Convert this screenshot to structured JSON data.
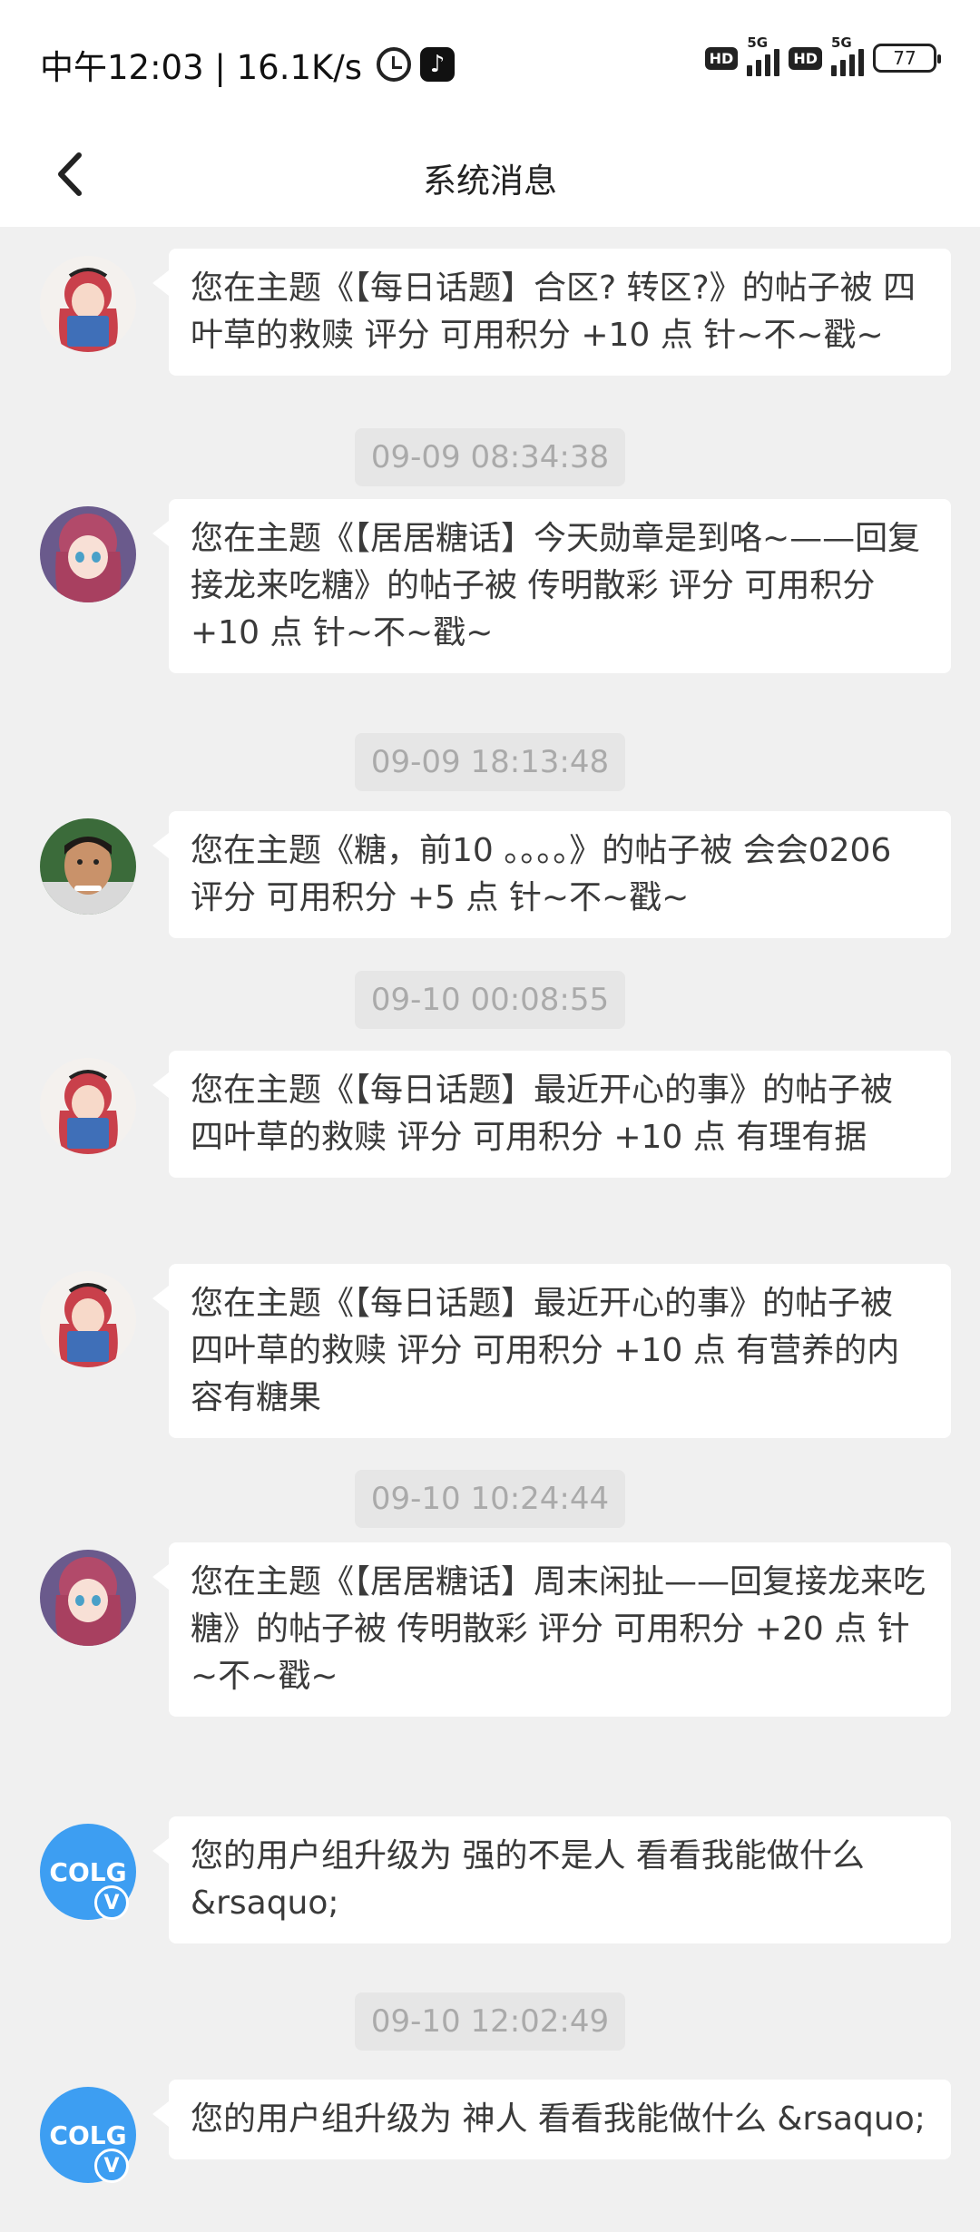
{
  "status_bar": {
    "time_speed": "中午12:03 | 16.1K/s",
    "network_1": "5G",
    "network_2": "5G",
    "hd_label": "HD",
    "battery": "77"
  },
  "nav": {
    "title": "系统消息"
  },
  "messages": [
    {
      "type": "message",
      "avatar": "anime-girl-book",
      "text": "您在主题《【每日话题】合区? 转区?》的帖子被 四叶草的救赎 评分 可用积分 +10 点 针~不~戳~"
    },
    {
      "type": "timestamp",
      "text": "09-09 08:34:38"
    },
    {
      "type": "message",
      "avatar": "anime-girl-purple",
      "text": "您在主题《【居居糖话】今天勋章是到咯~——回复接龙来吃糖》的帖子被 传明散彩 评分 可用积分 +10 点 针~不~戳~"
    },
    {
      "type": "timestamp",
      "text": "09-09 18:13:48"
    },
    {
      "type": "message",
      "avatar": "man-photo",
      "text": "您在主题《糖，前10 。。。。》的帖子被 会会0206 评分 可用积分 +5 点 针~不~戳~"
    },
    {
      "type": "timestamp",
      "text": "09-10 00:08:55"
    },
    {
      "type": "message",
      "avatar": "anime-girl-book",
      "text": "您在主题《【每日话题】最近开心的事》的帖子被 四叶草的救赎 评分 可用积分 +10 点 有理有据"
    },
    {
      "type": "message",
      "avatar": "anime-girl-book",
      "text": "您在主题《【每日话题】最近开心的事》的帖子被 四叶草的救赎 评分 可用积分 +10 点 有营养的内容有糖果"
    },
    {
      "type": "timestamp",
      "text": "09-10 10:24:44"
    },
    {
      "type": "message",
      "avatar": "anime-girl-purple",
      "text": "您在主题《【居居糖话】周末闲扯——回复接龙来吃糖》的帖子被 传明散彩 评分 可用积分 +20 点 针~不~戳~"
    },
    {
      "type": "message",
      "avatar": "colg-logo",
      "text": "您的用户组升级为 强的不是人  看看我能做什么 &rsaquo;"
    },
    {
      "type": "timestamp",
      "text": "09-10 12:02:49"
    },
    {
      "type": "message",
      "avatar": "colg-logo",
      "text": "您的用户组升级为 神人  看看我能做什么 &rsaquo;"
    }
  ],
  "colg_logo_text": "COLG",
  "colg_badge_text": "V",
  "colors": {
    "background": "#f0f0f0",
    "bubble": "#ffffff",
    "timestamp_bg": "#e6e6e6",
    "timestamp_text": "#aaaaaa",
    "colg_blue": "#3d9ef2"
  }
}
